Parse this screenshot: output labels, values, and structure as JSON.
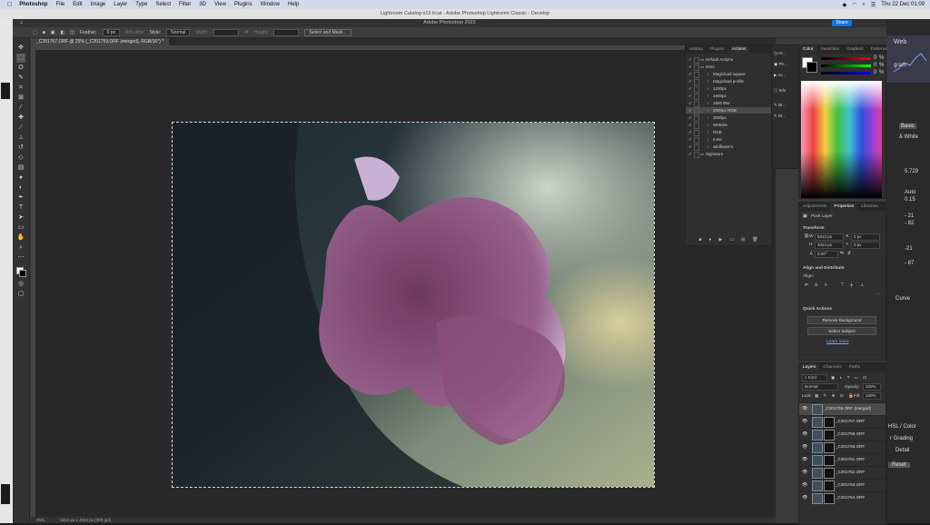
{
  "menubar": {
    "apple": "",
    "items": [
      "Photoshop",
      "File",
      "Edit",
      "Image",
      "Layer",
      "Type",
      "Select",
      "Filter",
      "3D",
      "View",
      "Plugins",
      "Window",
      "Help"
    ],
    "clock": "Thu 22 Dec 01:09"
  },
  "lightroom": {
    "title": "Lightroom Catalog-v12.lrcat - Adobe Photoshop Lightroom Classic - Develop",
    "right_labels": {
      "web": "Web",
      "histogram": "gram",
      "basic": "Basic",
      "bw": "& White",
      "v1": "5,729",
      "v2": "0.15",
      "auto": "Auto",
      "v3": "- 21",
      "v4": "- 82",
      "v5": "-21",
      "v6": "- 87",
      "curve": "Curve",
      "hsl": "HSL / Color",
      "grading": "r Grading",
      "detail": "Detail",
      "reset": "Reset"
    }
  },
  "ps": {
    "app_title": "Adobe Photoshop 2023",
    "home_icon": "⌂",
    "share": "Share",
    "options": {
      "feather_label": "Feather:",
      "feather_value": "0 px",
      "antialias": "Anti-alias",
      "style_label": "Style:",
      "style_value": "Normal",
      "width_label": "Width:",
      "height_label": "Height:",
      "select_mask": "Select and Mask..."
    },
    "tab": "_C201767.ORF @ 25% (_C201759.ORF (merged), RGB/16*) *",
    "status": {
      "zoom": "25%",
      "dimensions": "5312 px x 4024 px (300 ppi)"
    }
  },
  "actions_panel": {
    "tabs": [
      "History",
      "Plugins",
      "Actions"
    ],
    "rows": [
      {
        "label": "Default Actions",
        "indent": 0,
        "folder": true
      },
      {
        "label": "Mine",
        "indent": 0,
        "folder": true
      },
      {
        "label": "Magicload square",
        "indent": 1
      },
      {
        "label": "Magicload profile",
        "indent": 1
      },
      {
        "label": "1200px",
        "indent": 1
      },
      {
        "label": "1600px",
        "indent": 1
      },
      {
        "label": "1600 BW",
        "indent": 1
      },
      {
        "label": "2000px RGB",
        "indent": 1,
        "selected": true
      },
      {
        "label": "3000px",
        "indent": 1
      },
      {
        "label": "Website",
        "indent": 1
      },
      {
        "label": "RGB",
        "indent": 1
      },
      {
        "label": "Insta",
        "indent": 1
      },
      {
        "label": "wildflowers",
        "indent": 1
      },
      {
        "label": "Signature",
        "indent": 0,
        "folder": true
      }
    ]
  },
  "minidock": {
    "items": [
      "Hi...",
      "Ph...",
      "Ac...",
      "Info",
      "Br...",
      "Br..."
    ]
  },
  "color_panel": {
    "tabs": [
      "Color",
      "Swatches",
      "Gradient",
      "Patterns"
    ],
    "values": [
      "0",
      "0",
      "0"
    ],
    "unit": "%"
  },
  "properties_panel": {
    "tabs": [
      "Adjustments",
      "Properties",
      "Libraries"
    ],
    "layer_type": "Pixel Layer",
    "transform_label": "Transform",
    "w_label": "W",
    "w_value": "5312 px",
    "x_label": "X",
    "x_value": "0 px",
    "h_label": "H",
    "h_value": "4024 px",
    "y_label": "Y",
    "y_value": "0 px",
    "angle": "0.00°",
    "align_label": "Align and Distribute",
    "align_sub": "Align:",
    "quick_label": "Quick Actions",
    "remove_bg": "Remove Background",
    "select_subject": "Select Subject",
    "learn_more": "Learn more"
  },
  "layers_panel": {
    "tabs": [
      "Layers",
      "Channels",
      "Paths"
    ],
    "kind": "Kind",
    "blend": "Normal",
    "opacity_label": "Opacity:",
    "opacity": "100%",
    "lock_label": "Lock:",
    "fill_label": "Fill:",
    "fill": "100%",
    "layers": [
      {
        "name": "_C201759.ORF (merged)",
        "selected": true,
        "mask": false
      },
      {
        "name": "_C201767.ORF",
        "mask": true
      },
      {
        "name": "_C201759.ORF",
        "mask": true
      },
      {
        "name": "_C201768.ORF",
        "mask": true
      },
      {
        "name": "_C201761.ORF",
        "mask": true
      },
      {
        "name": "_C201762.ORF",
        "mask": true
      },
      {
        "name": "_C201763.ORF",
        "mask": true
      },
      {
        "name": "_C201764.ORF",
        "mask": true
      }
    ]
  },
  "colors": {
    "accent": "#1473e6",
    "panel": "#2f2f2f",
    "fungus": "#8b4d7a"
  }
}
